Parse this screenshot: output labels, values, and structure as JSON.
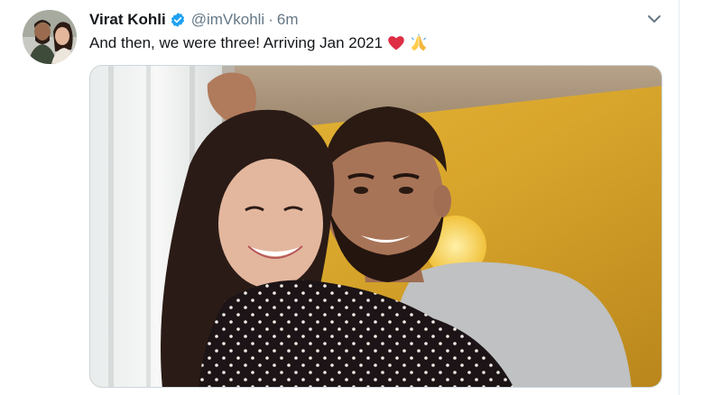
{
  "tweet": {
    "display_name": "Virat Kohli",
    "handle": "@imVkohli",
    "separator": "·",
    "time": "6m",
    "text": "And then, we were three! Arriving Jan 2021",
    "emojis": [
      "red-heart-emoji",
      "folded-hands-emoji"
    ],
    "verified": true
  },
  "colors": {
    "name": "#14171a",
    "muted": "#657786",
    "verified_badge": "#1da1f2",
    "divider": "#e6ecf0"
  },
  "icons": {
    "more_menu": "chevron-down-icon",
    "verified": "verified-badge-icon"
  }
}
